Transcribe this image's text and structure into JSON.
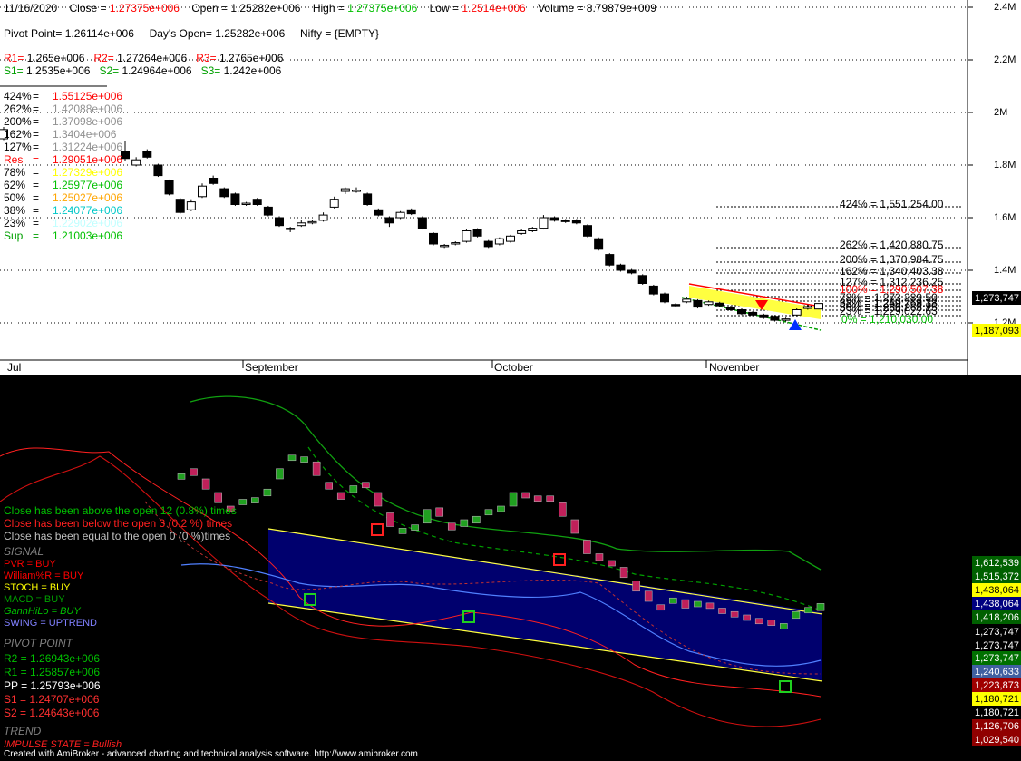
{
  "header": {
    "date": "11/16/2020",
    "close_label": "Close =",
    "close_value": "1.27375e+006",
    "open_label": "Open =",
    "open_value": "1.25282e+006",
    "high_label": "High =",
    "high_value": "1.27375e+006",
    "low_label": "Low =",
    "low_value": "1.2514e+006",
    "volume_label": "Volume =",
    "volume_value": "8.79879e+009"
  },
  "pivot_line": {
    "pivot": "Pivot Point= 1.26114e+006",
    "days_open": "Day's Open= 1.25282e+006",
    "nifty": "Nifty = {EMPTY}"
  },
  "levels_r": [
    {
      "label": "R1=",
      "value": "1.265e+006"
    },
    {
      "label": "R2=",
      "value": "1.27264e+006"
    },
    {
      "label": "R3=",
      "value": "1.2765e+006"
    }
  ],
  "levels_s": [
    {
      "label": "S1=",
      "value": "1.2535e+006"
    },
    {
      "label": "S2=",
      "value": "1.24964e+006"
    },
    {
      "label": "S3=",
      "value": "1.242e+006"
    }
  ],
  "fib_left": [
    {
      "label": "424%",
      "eq": "=",
      "value": "1.55125e+006",
      "color": "#ff0000"
    },
    {
      "label": "262%",
      "eq": "=",
      "value": "1.42088e+006",
      "color": "#909090"
    },
    {
      "label": "200%",
      "eq": "=",
      "value": "1.37098e+006",
      "color": "#909090"
    },
    {
      "label": "162%",
      "eq": "=",
      "value": "1.3404e+006",
      "color": "#909090"
    },
    {
      "label": "127%",
      "eq": "=",
      "value": "1.31224e+006",
      "color": "#909090"
    },
    {
      "label": "Res",
      "eq": "=",
      "value": "1.29051e+006",
      "color": "#ff0000"
    },
    {
      "label": "78%",
      "eq": "=",
      "value": "1.27329e+006",
      "color": "#ffff00"
    },
    {
      "label": "62%",
      "eq": "=",
      "value": "1.25977e+006",
      "color": "#00c000"
    },
    {
      "label": "50%",
      "eq": "=",
      "value": "1.25027e+006",
      "color": "#ffa500"
    },
    {
      "label": "38%",
      "eq": "=",
      "value": "1.24077e+006",
      "color": "#00c8c8"
    },
    {
      "label": "23%",
      "eq": "=",
      "value": "1.22902e+006",
      "color": "#c0ffff"
    },
    {
      "label": "Sup",
      "eq": "=",
      "value": "1.21003e+006",
      "color": "#00c000"
    }
  ],
  "fib_right": [
    {
      "text": "424% = 1,551,254.00",
      "color": "#000000"
    },
    {
      "text": "262% = 1,420,880.75",
      "color": "#000000"
    },
    {
      "text": "200% = 1,370,984.75",
      "color": "#000000"
    },
    {
      "text": "162% = 1,340,403.38",
      "color": "#000000"
    },
    {
      "text": "127% = 1,312,236.25",
      "color": "#000000"
    },
    {
      "text": "100% = 1,290,507.38",
      "color": "#ff0000"
    },
    {
      "text": "78% = 1,273,289.50",
      "color": "#000000"
    },
    {
      "text": "62% = 1,259,768.38",
      "color": "#000000"
    },
    {
      "text": "50% = 1,250,268.75",
      "color": "#000000"
    },
    {
      "text": "38% = 1,240,769.13",
      "color": "#000000"
    },
    {
      "text": "23% = 1,229,022.63",
      "color": "#000000"
    },
    {
      "text": "0% = 1,210,030.00",
      "color": "#00c000"
    }
  ],
  "price_axis": {
    "labels": [
      "2.4M",
      "2.2M",
      "2M",
      "1.8M",
      "1.6M",
      "1.4M",
      "1.2M"
    ],
    "badge_close": "1,273,747",
    "badge_low": "1,187,093"
  },
  "months": [
    "Jul",
    "September",
    "October",
    "November"
  ],
  "stats": {
    "above": "Close has been above the open 12 (0.8%) times",
    "below": "Close has been below the open 3 (0.2 %) times",
    "equal": "Close has been equal to the open 0 (0 %)times"
  },
  "signal": {
    "title": "SIGNAL",
    "items": [
      {
        "text": "PVR = BUY",
        "color": "#ff0000"
      },
      {
        "text": "William%R = BUY",
        "color": "#ff0000"
      },
      {
        "text": "STOCH = BUY",
        "color": "#ffff00"
      },
      {
        "text": "MACD = BUY",
        "color": "#00a000"
      },
      {
        "text": "GannHiLo = BUY",
        "color": "#00c000"
      },
      {
        "text": "SWING = UPTREND",
        "color": "#8080ff"
      }
    ]
  },
  "pivot_point": {
    "title": "PIVOT POINT",
    "items": [
      {
        "text": "R2 = 1.26943e+006",
        "color": "#00c000"
      },
      {
        "text": "R1 = 1.25857e+006",
        "color": "#00c000"
      },
      {
        "text": "PP = 1.25793e+006",
        "color": "#ffffff"
      },
      {
        "text": "S1 = 1.24707e+006",
        "color": "#ff3030"
      },
      {
        "text": "S2 = 1.24643e+006",
        "color": "#ff3030"
      }
    ]
  },
  "trend": {
    "title": "TREND",
    "impulse": "IMPULSE STATE = Bullish"
  },
  "bottom_axis_badges": [
    {
      "text": "1,612,539",
      "bg": "#006000",
      "fg": "#ffffff"
    },
    {
      "text": "1,515,372",
      "bg": "#006000",
      "fg": "#ffffff"
    },
    {
      "text": "1,438,064",
      "bg": "#ffff00",
      "fg": "#000000"
    },
    {
      "text": "1,438,064",
      "bg": "#000080",
      "fg": "#ffffff"
    },
    {
      "text": "1,418,206",
      "bg": "#006000",
      "fg": "#ffffff"
    },
    {
      "text": "1,273,747",
      "bg": "#000000",
      "fg": "#ffffff"
    },
    {
      "text": "1,273,747",
      "bg": "#000000",
      "fg": "#ffffff"
    },
    {
      "text": "1,273,747",
      "bg": "#007000",
      "fg": "#ffffff"
    },
    {
      "text": "1,240,633",
      "bg": "#4060a0",
      "fg": "#ffffff"
    },
    {
      "text": "1,223,873",
      "bg": "#a00000",
      "fg": "#ffffff"
    },
    {
      "text": "1,180,721",
      "bg": "#ffff00",
      "fg": "#000000"
    },
    {
      "text": "1,180,721",
      "bg": "#000000",
      "fg": "#ffffff"
    },
    {
      "text": "1,126,706",
      "bg": "#900000",
      "fg": "#ffffff"
    },
    {
      "text": "1,029,540",
      "bg": "#900000",
      "fg": "#ffffff"
    }
  ],
  "footer": "Created with AmiBroker - advanced charting and technical analysis software. http://www.amibroker.com",
  "chart_data": {
    "type": "candlestick",
    "title": "",
    "ylim": [
      1150000,
      2450000
    ],
    "yticks": [
      1200000,
      1400000,
      1600000,
      1800000,
      2000000,
      2200000,
      2400000
    ],
    "x_labels": [
      "Jul",
      "September",
      "October",
      "November"
    ],
    "candles": [
      {
        "o": 1900000,
        "c": 1935000,
        "h": 1945000,
        "l": 1895000
      },
      {
        "o": 1850000,
        "c": 1825000,
        "h": 1890000,
        "l": 1815000
      },
      {
        "o": 1800000,
        "c": 1820000,
        "h": 1830000,
        "l": 1795000
      },
      {
        "o": 1850000,
        "c": 1830000,
        "h": 1860000,
        "l": 1825000
      },
      {
        "o": 1800000,
        "c": 1760000,
        "h": 1805000,
        "l": 1755000
      },
      {
        "o": 1740000,
        "c": 1690000,
        "h": 1745000,
        "l": 1685000
      },
      {
        "o": 1670000,
        "c": 1620000,
        "h": 1675000,
        "l": 1615000
      },
      {
        "o": 1630000,
        "c": 1660000,
        "h": 1670000,
        "l": 1625000
      },
      {
        "o": 1680000,
        "c": 1720000,
        "h": 1730000,
        "l": 1675000
      },
      {
        "o": 1750000,
        "c": 1730000,
        "h": 1760000,
        "l": 1725000
      },
      {
        "o": 1710000,
        "c": 1680000,
        "h": 1715000,
        "l": 1675000
      },
      {
        "o": 1690000,
        "c": 1650000,
        "h": 1695000,
        "l": 1645000
      },
      {
        "o": 1650000,
        "c": 1655000,
        "h": 1660000,
        "l": 1645000
      },
      {
        "o": 1670000,
        "c": 1650000,
        "h": 1675000,
        "l": 1645000
      },
      {
        "o": 1640000,
        "c": 1610000,
        "h": 1645000,
        "l": 1605000
      },
      {
        "o": 1600000,
        "c": 1570000,
        "h": 1605000,
        "l": 1565000
      },
      {
        "o": 1560000,
        "c": 1555000,
        "h": 1565000,
        "l": 1545000
      },
      {
        "o": 1570000,
        "c": 1580000,
        "h": 1590000,
        "l": 1565000
      },
      {
        "o": 1580000,
        "c": 1585000,
        "h": 1590000,
        "l": 1575000
      },
      {
        "o": 1590000,
        "c": 1610000,
        "h": 1620000,
        "l": 1585000
      },
      {
        "o": 1640000,
        "c": 1670000,
        "h": 1680000,
        "l": 1635000
      },
      {
        "o": 1700000,
        "c": 1710000,
        "h": 1715000,
        "l": 1690000
      },
      {
        "o": 1700000,
        "c": 1705000,
        "h": 1715000,
        "l": 1695000
      },
      {
        "o": 1690000,
        "c": 1650000,
        "h": 1695000,
        "l": 1645000
      },
      {
        "o": 1630000,
        "c": 1610000,
        "h": 1635000,
        "l": 1605000
      },
      {
        "o": 1600000,
        "c": 1580000,
        "h": 1605000,
        "l": 1565000
      },
      {
        "o": 1600000,
        "c": 1620000,
        "h": 1625000,
        "l": 1595000
      },
      {
        "o": 1630000,
        "c": 1615000,
        "h": 1635000,
        "l": 1610000
      },
      {
        "o": 1600000,
        "c": 1560000,
        "h": 1605000,
        "l": 1555000
      },
      {
        "o": 1540000,
        "c": 1500000,
        "h": 1545000,
        "l": 1495000
      },
      {
        "o": 1490000,
        "c": 1495000,
        "h": 1500000,
        "l": 1485000
      },
      {
        "o": 1500000,
        "c": 1505000,
        "h": 1510000,
        "l": 1495000
      },
      {
        "o": 1510000,
        "c": 1550000,
        "h": 1555000,
        "l": 1505000
      },
      {
        "o": 1555000,
        "c": 1530000,
        "h": 1560000,
        "l": 1525000
      },
      {
        "o": 1510000,
        "c": 1490000,
        "h": 1515000,
        "l": 1485000
      },
      {
        "o": 1500000,
        "c": 1520000,
        "h": 1525000,
        "l": 1495000
      },
      {
        "o": 1510000,
        "c": 1530000,
        "h": 1535000,
        "l": 1505000
      },
      {
        "o": 1540000,
        "c": 1550000,
        "h": 1555000,
        "l": 1535000
      },
      {
        "o": 1550000,
        "c": 1560000,
        "h": 1565000,
        "l": 1545000
      },
      {
        "o": 1560000,
        "c": 1600000,
        "h": 1610000,
        "l": 1555000
      },
      {
        "o": 1600000,
        "c": 1590000,
        "h": 1605000,
        "l": 1585000
      },
      {
        "o": 1590000,
        "c": 1585000,
        "h": 1595000,
        "l": 1580000
      },
      {
        "o": 1590000,
        "c": 1580000,
        "h": 1595000,
        "l": 1575000
      },
      {
        "o": 1570000,
        "c": 1530000,
        "h": 1575000,
        "l": 1525000
      },
      {
        "o": 1520000,
        "c": 1480000,
        "h": 1525000,
        "l": 1475000
      },
      {
        "o": 1460000,
        "c": 1420000,
        "h": 1465000,
        "l": 1415000
      },
      {
        "o": 1420000,
        "c": 1400000,
        "h": 1425000,
        "l": 1395000
      },
      {
        "o": 1400000,
        "c": 1390000,
        "h": 1405000,
        "l": 1385000
      },
      {
        "o": 1380000,
        "c": 1350000,
        "h": 1385000,
        "l": 1345000
      },
      {
        "o": 1340000,
        "c": 1310000,
        "h": 1345000,
        "l": 1305000
      },
      {
        "o": 1310000,
        "c": 1280000,
        "h": 1315000,
        "l": 1275000
      },
      {
        "o": 1270000,
        "c": 1265000,
        "h": 1275000,
        "l": 1260000
      },
      {
        "o": 1280000,
        "c": 1290000,
        "h": 1300000,
        "l": 1275000
      },
      {
        "o": 1285000,
        "c": 1260000,
        "h": 1290000,
        "l": 1255000
      },
      {
        "o": 1270000,
        "c": 1280000,
        "h": 1285000,
        "l": 1265000
      },
      {
        "o": 1275000,
        "c": 1265000,
        "h": 1280000,
        "l": 1260000
      },
      {
        "o": 1260000,
        "c": 1250000,
        "h": 1265000,
        "l": 1245000
      },
      {
        "o": 1250000,
        "c": 1235000,
        "h": 1255000,
        "l": 1230000
      },
      {
        "o": 1240000,
        "c": 1230000,
        "h": 1245000,
        "l": 1225000
      },
      {
        "o": 1230000,
        "c": 1220000,
        "h": 1235000,
        "l": 1215000
      },
      {
        "o": 1225000,
        "c": 1210000,
        "h": 1230000,
        "l": 1205000
      },
      {
        "o": 1210000,
        "c": 1215000,
        "h": 1220000,
        "l": 1205000
      },
      {
        "o": 1230000,
        "c": 1250000,
        "h": 1255000,
        "l": 1225000
      },
      {
        "o": 1255000,
        "c": 1262000,
        "h": 1270000,
        "l": 1250000
      },
      {
        "o": 1252820,
        "c": 1273750,
        "h": 1273750,
        "l": 1251400
      }
    ]
  }
}
